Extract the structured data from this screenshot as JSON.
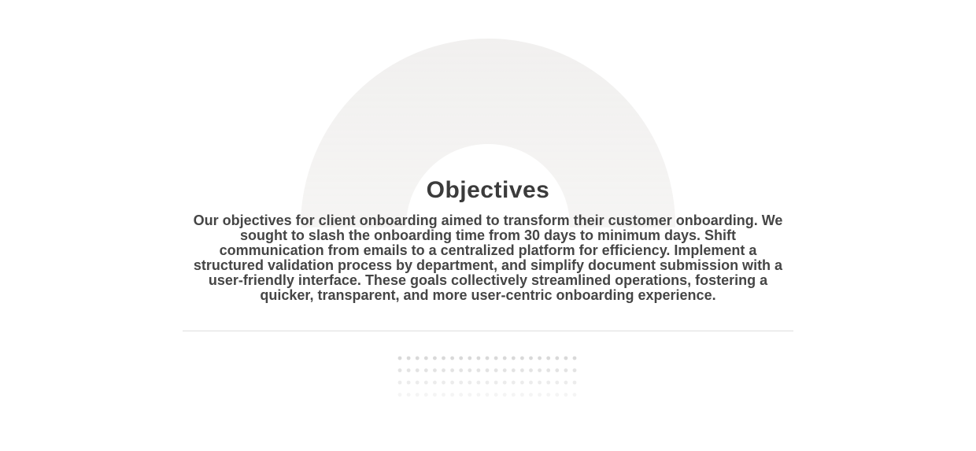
{
  "section": {
    "title": "Objectives",
    "description": "Our objectives for client onboarding aimed to transform their customer onboarding. We sought to slash the onboarding time from 30 days to minimum days. Shift communication from emails to a centralized platform for efficiency. Implement a structured validation process by department, and simplify document submission with a user-friendly interface. These goals collectively streamlined operations, fostering a quicker, transparent, and more user-centric onboarding experience."
  },
  "decoration": {
    "arc_color": "#f2f1f0",
    "dot_color": "#d9d9d9",
    "divider_color": "#dedede"
  }
}
